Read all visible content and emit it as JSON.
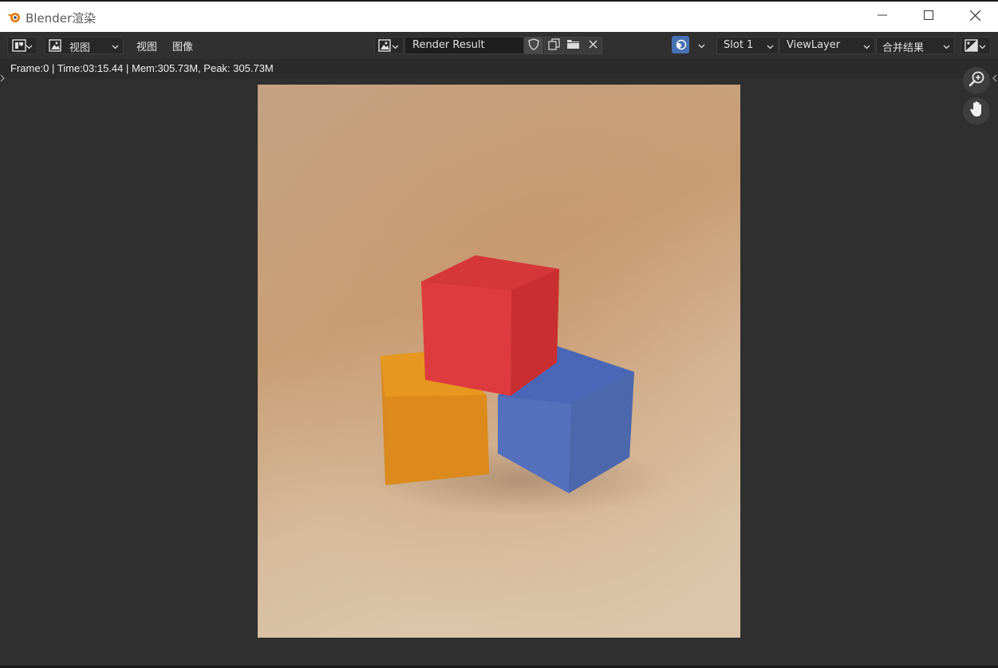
{
  "window": {
    "title": "Blender渲染",
    "minimize_icon": "minimize-icon",
    "maximize_icon": "maximize-icon",
    "close_icon": "close-icon"
  },
  "toolbar": {
    "editor_type_icon": "image-editor-icon",
    "view_mode": "视图",
    "menu_view": "视图",
    "menu_image": "图像",
    "image_name": "Render Result",
    "slot": "Slot 1",
    "view_layer": "ViewLayer",
    "pass": "合并结果"
  },
  "status": {
    "text": "Frame:0 | Time:03:15.44 | Mem:305.73M, Peak: 305.73M"
  },
  "colors": {
    "accent": "#4772b3",
    "background": "#ceb79c",
    "red_cube": "#d8383a",
    "orange_cube": "#e08a1e",
    "blue_cube": "#4f6bb8"
  }
}
